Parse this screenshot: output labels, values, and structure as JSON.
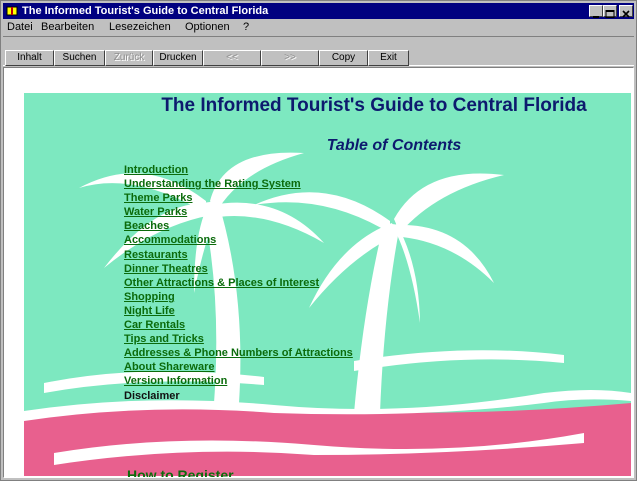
{
  "window": {
    "title": "The Informed Tourist's Guide to Central Florida"
  },
  "menu": [
    "Datei",
    "Bearbeiten",
    "Lesezeichen",
    "Optionen",
    "?"
  ],
  "toolbar": [
    "Inhalt",
    "Suchen",
    "Zurück",
    "Drucken",
    "<<",
    ">>",
    "Copy",
    "Exit"
  ],
  "page": {
    "title": "The Informed Tourist's Guide to Central Florida",
    "subtitle": "Table of Contents",
    "toc": [
      "Introduction",
      "Understanding the Rating System",
      "Theme Parks",
      "Water Parks",
      "Beaches",
      "Accommodations",
      "Restaurants",
      "Dinner Theatres",
      "Other Attractions & Places of Interest",
      "Shopping",
      "Night Life",
      "Car Rentals",
      "Tips and Tricks",
      "Addresses & Phone Numbers of Attractions",
      "About Shareware",
      "Version Information",
      "Disclaimer"
    ],
    "register": "How to Register"
  },
  "colors": {
    "mint": "#7de8c0",
    "pink": "#e8608e",
    "link": "#0b6b0b",
    "heading": "#0d1a6e"
  }
}
